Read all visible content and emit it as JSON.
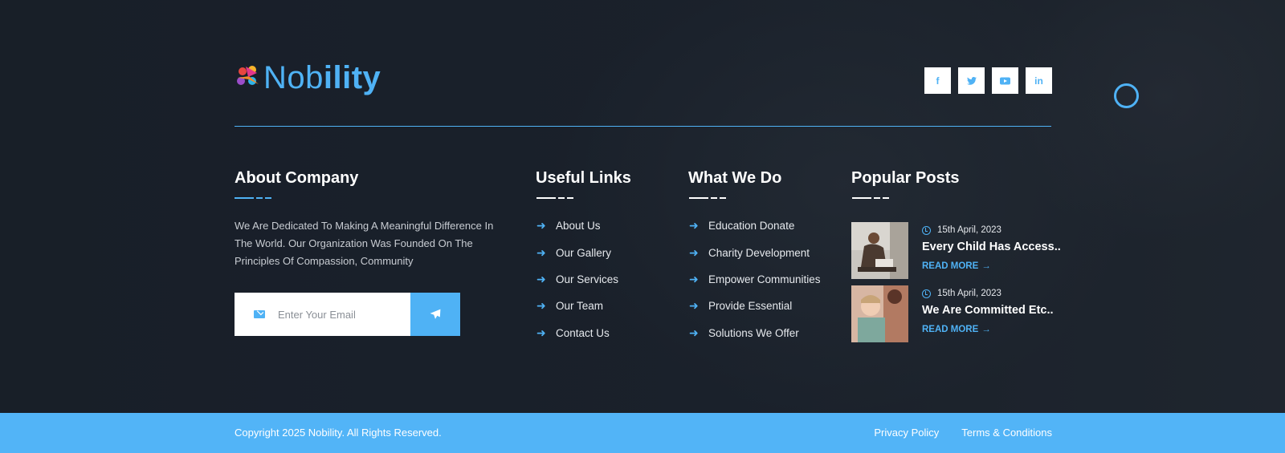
{
  "brand": {
    "name_light": "Nob",
    "name_bold": "ility",
    "accent_color": "#4fb2f5",
    "bar_color": "#52b4f7"
  },
  "social": [
    {
      "icon": "facebook-icon",
      "glyph": "f"
    },
    {
      "icon": "twitter-icon",
      "glyph": "t"
    },
    {
      "icon": "youtube-icon",
      "glyph": "▶"
    },
    {
      "icon": "linkedin-icon",
      "glyph": "in"
    }
  ],
  "about": {
    "title": "About Company",
    "text": "We Are Dedicated To Making A Meaningful Difference In The World. Our Organization Was Founded On The Principles Of Compassion, Community",
    "email_placeholder": "Enter Your Email",
    "submit_icon": "paper-plane-icon"
  },
  "useful_links": {
    "title": "Useful Links",
    "items": [
      "About Us",
      "Our Gallery",
      "Our Services",
      "Our Team",
      "Contact Us"
    ]
  },
  "what_we_do": {
    "title": "What We Do",
    "items": [
      "Education Donate",
      "Charity Development",
      "Empower Communities",
      "Provide Essential",
      "Solutions We Offer"
    ]
  },
  "popular_posts": {
    "title": "Popular Posts",
    "posts": [
      {
        "date": "15th April, 2023",
        "title": "Every Child Has Access..",
        "more": "READ MORE"
      },
      {
        "date": "15th April, 2023",
        "title": "We Are Committed Etc..",
        "more": "READ MORE"
      }
    ]
  },
  "bottom": {
    "copyright": "Copyright 2025 Nobility. All Rights Reserved.",
    "links": [
      "Privacy Policy",
      "Terms & Conditions"
    ]
  }
}
